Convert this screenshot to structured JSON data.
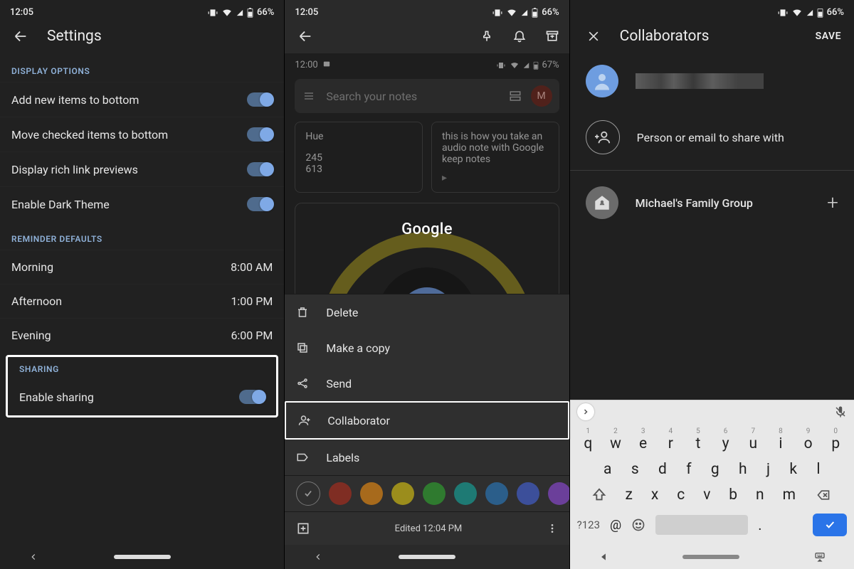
{
  "status": {
    "time": "12:05",
    "battery": "66%"
  },
  "screen1": {
    "title": "Settings",
    "display_header": "DISPLAY OPTIONS",
    "items": [
      {
        "label": "Add new items to bottom"
      },
      {
        "label": "Move checked items to bottom"
      },
      {
        "label": "Display rich link previews"
      },
      {
        "label": "Enable Dark Theme"
      }
    ],
    "reminder_header": "REMINDER DEFAULTS",
    "reminders": [
      {
        "label": "Morning",
        "value": "8:00 AM"
      },
      {
        "label": "Afternoon",
        "value": "1:00 PM"
      },
      {
        "label": "Evening",
        "value": "6:00 PM"
      }
    ],
    "sharing_header": "SHARING",
    "sharing_label": "Enable sharing"
  },
  "screen2": {
    "preview": {
      "time": "12:00",
      "battery": "67%",
      "search_placeholder": "Search your notes",
      "avatar_letter": "M",
      "note1_title": "Hue",
      "note1_body1": "245",
      "note1_body2": "613",
      "note2_body": "this is how you take an audio note with Google keep notes",
      "big_word": "Google"
    },
    "sheet": {
      "items": [
        {
          "label": "Delete"
        },
        {
          "label": "Make a copy"
        },
        {
          "label": "Send"
        },
        {
          "label": "Collaborator"
        },
        {
          "label": "Labels"
        }
      ],
      "colors": [
        "#7f2d23",
        "#a76a1c",
        "#9b8d1c",
        "#2f7a2f",
        "#1e7a74",
        "#2b5e8a",
        "#3c4f9a",
        "#6b3f9a"
      ],
      "edited": "Edited 12:04 PM"
    }
  },
  "screen3": {
    "title": "Collaborators",
    "save": "SAVE",
    "share_placeholder": "Person or email to share with",
    "family": "Michael's Family Group",
    "keyboard": {
      "row1_hints": [
        "1",
        "2",
        "3",
        "4",
        "5",
        "6",
        "7",
        "8",
        "9",
        "0"
      ],
      "row1": [
        "q",
        "w",
        "e",
        "r",
        "t",
        "y",
        "u",
        "i",
        "o",
        "p"
      ],
      "row2": [
        "a",
        "s",
        "d",
        "f",
        "g",
        "h",
        "j",
        "k",
        "l"
      ],
      "row3": [
        "z",
        "x",
        "c",
        "v",
        "b",
        "n",
        "m"
      ],
      "sym": "?123",
      "at": "@",
      "dot": "."
    }
  }
}
